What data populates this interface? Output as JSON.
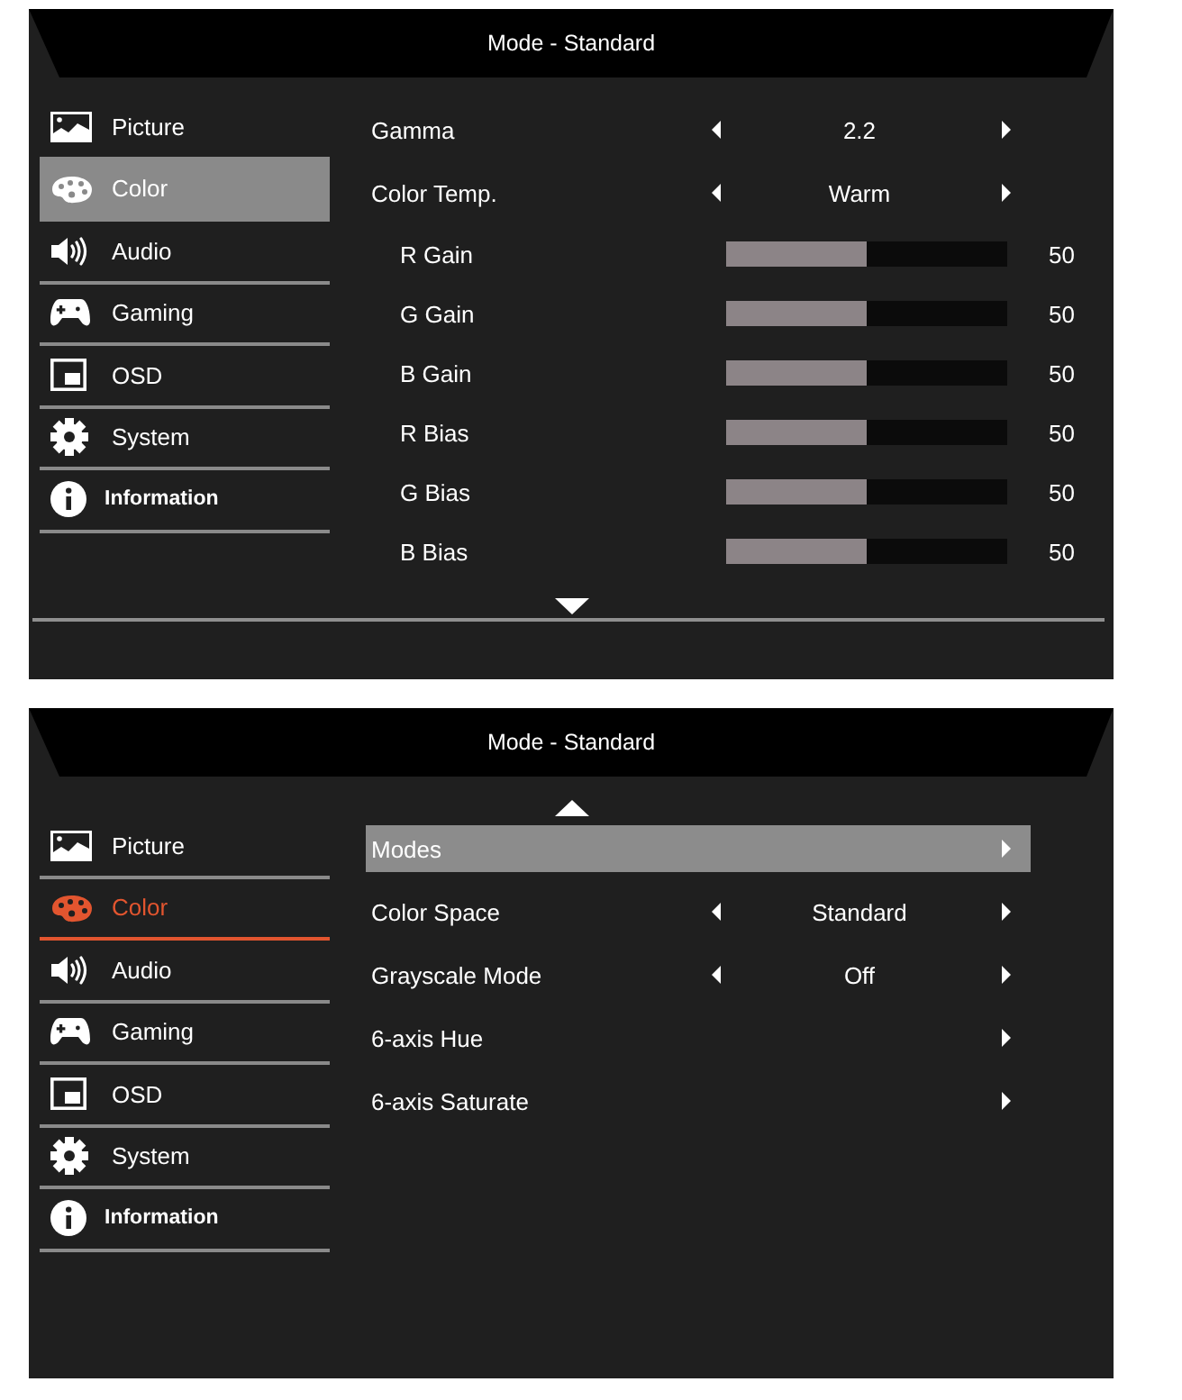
{
  "panels": [
    {
      "title": "Mode - Standard",
      "menu_focused": true,
      "more_above": false,
      "more_below": true,
      "menu": [
        {
          "label": "Picture",
          "selected": false
        },
        {
          "label": "Color",
          "selected": true
        },
        {
          "label": "Audio",
          "selected": false
        },
        {
          "label": "Gaming",
          "selected": false
        },
        {
          "label": "OSD",
          "selected": false
        },
        {
          "label": "System",
          "selected": false
        },
        {
          "label": "Information",
          "selected": false
        }
      ],
      "items": [
        {
          "kind": "choice",
          "label": "Gamma",
          "value": "2.2",
          "selected": false
        },
        {
          "kind": "choice",
          "label": "Color Temp.",
          "value": "Warm",
          "selected": false,
          "children": [
            {
              "kind": "slider",
              "label": "R Gain",
              "level": 0.5,
              "reading": "50",
              "selected": false
            },
            {
              "kind": "slider",
              "label": "G Gain",
              "level": 0.5,
              "reading": "50",
              "selected": false
            },
            {
              "kind": "slider",
              "label": "B Gain",
              "level": 0.5,
              "reading": "50",
              "selected": false
            },
            {
              "kind": "slider",
              "label": "R Bias",
              "level": 0.5,
              "reading": "50",
              "selected": false
            },
            {
              "kind": "slider",
              "label": "G Bias",
              "level": 0.5,
              "reading": "50",
              "selected": false
            },
            {
              "kind": "slider",
              "label": "B Bias",
              "level": 0.5,
              "reading": "50",
              "selected": false
            }
          ]
        }
      ]
    },
    {
      "title": "Mode - Standard",
      "menu_focused": false,
      "more_above": true,
      "more_below": false,
      "menu": [
        {
          "label": "Picture",
          "selected": false
        },
        {
          "label": "Color",
          "selected": true
        },
        {
          "label": "Audio",
          "selected": false
        },
        {
          "label": "Gaming",
          "selected": false
        },
        {
          "label": "OSD",
          "selected": false
        },
        {
          "label": "System",
          "selected": false
        },
        {
          "label": "Information",
          "selected": false
        }
      ],
      "items": [
        {
          "kind": "submenu",
          "label": "Modes",
          "selected": true
        },
        {
          "kind": "choice",
          "label": "Color Space",
          "value": "Standard",
          "selected": false
        },
        {
          "kind": "choice",
          "label": "Grayscale Mode",
          "value": "Off",
          "selected": false
        },
        {
          "kind": "submenu",
          "label": "6-axis Hue",
          "selected": false
        },
        {
          "kind": "submenu",
          "label": "6-axis Saturate",
          "selected": false
        }
      ]
    }
  ]
}
